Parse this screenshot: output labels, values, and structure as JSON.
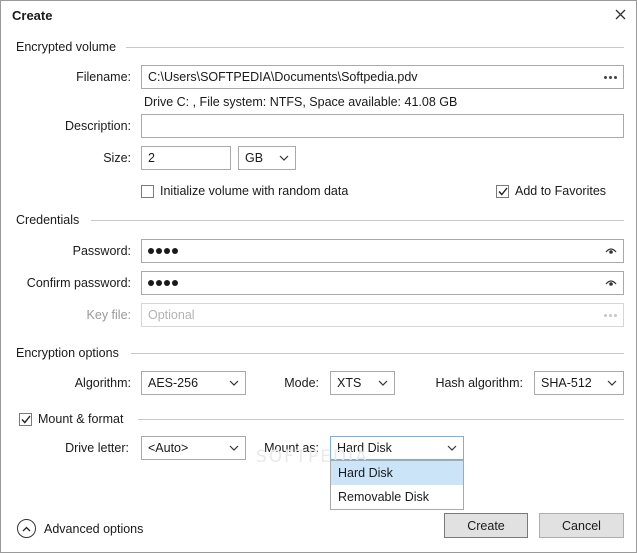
{
  "window": {
    "title": "Create"
  },
  "encrypted_volume": {
    "section_title": "Encrypted volume",
    "filename_label": "Filename:",
    "filename_value": "C:\\Users\\SOFTPEDIA\\Documents\\Softpedia.pdv",
    "drive_info": "Drive C: , File system: NTFS, Space available: 41.08 GB",
    "description_label": "Description:",
    "description_value": "",
    "size_label": "Size:",
    "size_value": "2",
    "size_unit": "GB",
    "init_random_label": "Initialize volume with random data",
    "init_random_checked": false,
    "add_favorites_label": "Add to Favorites",
    "add_favorites_checked": true
  },
  "credentials": {
    "section_title": "Credentials",
    "password_label": "Password:",
    "confirm_label": "Confirm password:",
    "keyfile_label": "Key file:",
    "keyfile_placeholder": "Optional"
  },
  "encryption_options": {
    "section_title": "Encryption options",
    "algorithm_label": "Algorithm:",
    "algorithm_value": "AES-256",
    "mode_label": "Mode:",
    "mode_value": "XTS",
    "hash_label": "Hash algorithm:",
    "hash_value": "SHA-512"
  },
  "mount_format": {
    "section_title": "Mount & format",
    "checked": true,
    "drive_letter_label": "Drive letter:",
    "drive_letter_value": "<Auto>",
    "mount_as_label": "Mount as:",
    "mount_as_value": "Hard Disk",
    "mount_as_options": [
      "Hard Disk",
      "Removable Disk"
    ]
  },
  "footer": {
    "advanced_label": "Advanced options",
    "create_label": "Create",
    "cancel_label": "Cancel"
  },
  "watermark": "SOFTPEDIA"
}
